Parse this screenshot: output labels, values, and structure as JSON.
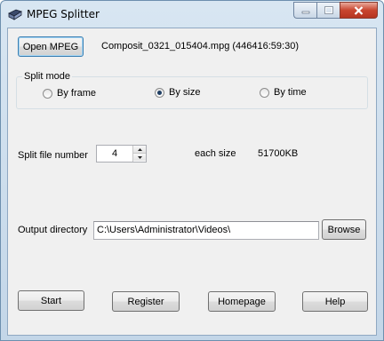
{
  "window": {
    "title": "MPEG Splitter",
    "app_icon": "mpeg-splitter-app-icon",
    "caption_buttons": [
      "minimize-icon",
      "maximize-icon",
      "close-icon"
    ],
    "close_button_color": "#c8452f"
  },
  "file": {
    "open_label": "Open MPEG",
    "info": "Composit_0321_015404.mpg  (446416:59:30)"
  },
  "split_mode": {
    "legend": "Split mode",
    "options": [
      {
        "label": "By frame",
        "selected": false
      },
      {
        "label": "By size",
        "selected": true
      },
      {
        "label": "By time",
        "selected": false
      }
    ]
  },
  "split": {
    "number_label": "Split file number",
    "number_value": "4",
    "each_size_label": "each size",
    "each_size_value": "51700KB"
  },
  "output": {
    "label": "Output directory",
    "value": "C:\\Users\\Administrator\\Videos\\",
    "browse_label": "Browse"
  },
  "actions": {
    "start_label": "Start",
    "register_label": "Register",
    "homepage_label": "Homepage",
    "help_label": "Help"
  }
}
